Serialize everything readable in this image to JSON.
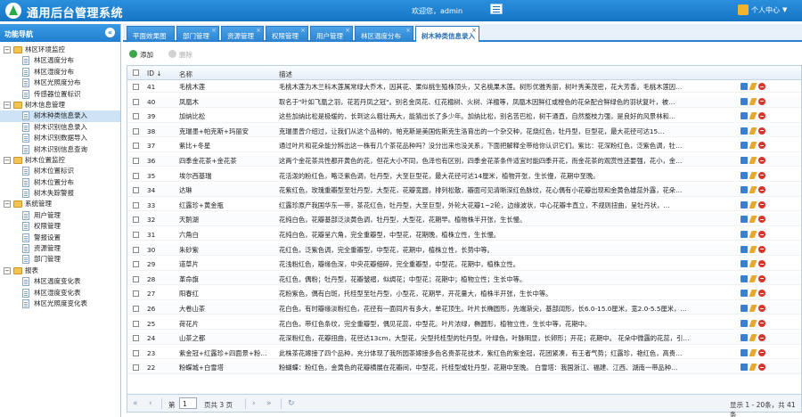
{
  "header": {
    "app_title": "通用后台管理系统",
    "welcome": "欢迎您，admin",
    "user_center": "个人中心"
  },
  "sidebar": {
    "title": "功能导航",
    "groups": [
      {
        "label": "林区环境监控",
        "items": [
          "林区温度分布",
          "林区湿度分布",
          "林区光照度分布",
          "传感器位置标识"
        ]
      },
      {
        "label": "树木信息管理",
        "items": [
          "树木种类信息录入",
          "树木识别信息录入",
          "树木识别数据导入",
          "树木识别信息查询"
        ]
      },
      {
        "label": "树木位置监控",
        "items": [
          "树木位置标识",
          "树木位置分布",
          "树木失踪警报"
        ]
      },
      {
        "label": "系统管理",
        "items": [
          "用户管理",
          "权限管理",
          "警报设置",
          "资源管理",
          "部门管理"
        ]
      },
      {
        "label": "报表",
        "items": [
          "林区温度变化表",
          "林区湿度变化表",
          "林区光照度变化表"
        ]
      }
    ],
    "selected": "树木种类信息录入"
  },
  "tabs": [
    "平面效果图",
    "部门管理",
    "资源管理",
    "权限管理",
    "用户管理",
    "林区温度分布",
    "树木种类信息录入"
  ],
  "toolbar": {
    "add": "添加",
    "delete": "删除"
  },
  "grid": {
    "columns": {
      "id": "ID",
      "name": "名称",
      "desc": "描述"
    },
    "rows": [
      {
        "id": "41",
        "name": "毛桃木莲",
        "desc": "毛桃木莲为木兰科木莲属常绿大乔木，因其花、果似桃生殖株顶头，又名桃果木莲。树形优雅秀丽，树叶秀美茂密，花大芳香。毛桃木莲因…"
      },
      {
        "id": "40",
        "name": "凤凰木",
        "desc": "取名于\"叶如飞凰之羽，花若丹凤之冠\"。别名金凤花、红花楹树、火树、洋楹等，凤凰木因鲜红或橙色的花朵配合鲜绿色的羽状复叶，被…"
      },
      {
        "id": "39",
        "name": "加纳比松",
        "desc": "这些加纳比松是极缓的，长到这么粗壮两大，能猜出长了多少年。加纳比松，别名苦巴松，树干通直，自然整枝力强，是良好的风景林和…"
      },
      {
        "id": "38",
        "name": "克瑞墨+帕克斯+玛丽安",
        "desc": "克瑞墨曾介绍过，让我们从这个品种的，帕克斯是美国佐斯克生洛育出的一个杂交种，花烧红色，牡丹型，巨型花，最大花径可达15…"
      },
      {
        "id": "37",
        "name": "紫比+冬星",
        "desc": "通过叶片和花朵能分辨出这一株有几个茶花品种吗？没分出来也没关系，下面把解释全带给你认识它们。紫比：花深粉红色，泛紫色调，牡…"
      },
      {
        "id": "36",
        "name": "四季金花茶+金花茶",
        "desc": "这两个金花茶共性都开黄色的花，但花大小不同，色泽也有区别，四季金花茶条件适宜时能四季开花，而金花茶的观赏性还要强，花小，金…"
      },
      {
        "id": "35",
        "name": "埃尔西基瑞",
        "desc": "花活泼的粉红色，略泛紫色调，牡丹型，大至巨型花，最大花径可达14厘米，植物开张，生长慢，花期中至晚。"
      },
      {
        "id": "34",
        "name": "达琳",
        "desc": "花紫红色，玫瑰重瓣型至牡丹型，大型花，花瓣宽圆，排列松散，瓣面可见清晰深红色脉纹，花心偶有小花瓣出现和金黄色雄蕊外露，花朵…"
      },
      {
        "id": "33",
        "name": "红露珍+黄金瓶",
        "desc": "红露珍原产我国华东一带，茶花红色，牡丹型，大至巨型，外轮大花瓣1~2轮，边缘波状，中心花瓣丰直立，不规则扭曲，呈牡丹状，…"
      },
      {
        "id": "32",
        "name": "天鹅湖",
        "desc": "花纯白色，花瓣基部泛淡黄色调，牡丹型，大型花，花期早。植物株半开张，生长慢。"
      },
      {
        "id": "31",
        "name": "六角白",
        "desc": "花纯白色，花瓣呈六角，完全重瓣型，中型花，花期晚，植株立性，生长慢。"
      },
      {
        "id": "30",
        "name": "朱砂紫",
        "desc": "花红色，泛紫色调，完全重瓣型，中型花，花期中，植株立性，长势中等。"
      },
      {
        "id": "29",
        "name": "道草片",
        "desc": "花浅粉红色，瓣缘色深，中央花瓣细碎，完全重瓣型，中型花，花期中，植株立性。"
      },
      {
        "id": "28",
        "name": "革命旗",
        "desc": "花红色，偶粉；牡丹型，花瓣皱褶，似绸花；中型花；花期中；植物立性；生长中等。"
      },
      {
        "id": "27",
        "name": "阳春红",
        "desc": "花粉紫色，偶有白斑，托桂型至牡丹型，小型花，花期早，开花量大，植株半开张，生长中等。"
      },
      {
        "id": "26",
        "name": "大卷山茶",
        "desc": "花白色，有时瓣缘淡粉红色，花径有一面同片有多大，单花顶生。叶片长椭圆形，先端渐尖，基部阔形，长6.0-15.0厘米，宽2.0-5.5厘米，…"
      },
      {
        "id": "25",
        "name": "荷花片",
        "desc": "花白色，带红色条纹，完全重瓣型，偶见花蕊，中型花。叶片浓绿，椭圆形，植物立性，生长中等，花期中。"
      },
      {
        "id": "24",
        "name": "山茶之都",
        "desc": "花深粉红色，花瓣扭曲，花径达13cm，大型花，尖型托桂型的牡丹型。叶绿色，叶脉明显，长卵形；开花；花期中。    花朵中微露的花蕊，引…"
      },
      {
        "id": "23",
        "name": "紫金冠+红露珍+四面景+粉…",
        "desc": "此株茶花嫁接了四个品种，充分体现了我所园茶嫁接多色名贵茶花技术，紫红色的紫金冠，花团紧凑，有王者气势；红露珍，艳红色，高贵…"
      },
      {
        "id": "22",
        "name": "粉蝶城+白雪塔",
        "desc": "粉蝴蝶：粉红色，金黄色的花瓣横展在花瓣间，中型花，托桂型或牡丹型，花期中至晚。  白雪塔：我国浙江、福建、江西、湖南一带品种…"
      }
    ]
  },
  "pager": {
    "page_prefix": "第",
    "page_value": "1",
    "page_suffix": "页共 3 页",
    "summary": "显示 1 - 20条，共 41 条"
  }
}
